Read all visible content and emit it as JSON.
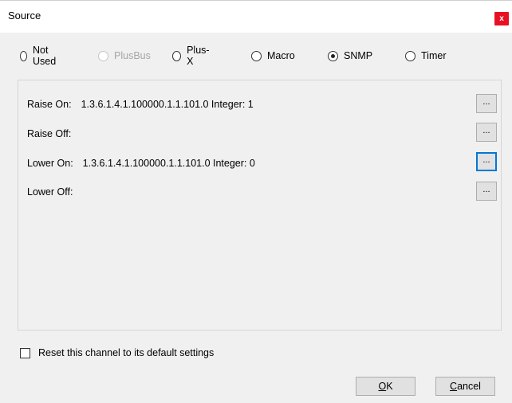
{
  "window": {
    "title": "Source",
    "close_label": "x"
  },
  "source_options": [
    {
      "label": "Not Used",
      "checked": false,
      "disabled": false
    },
    {
      "label": "PlusBus",
      "checked": false,
      "disabled": true
    },
    {
      "label": "Plus-X",
      "checked": false,
      "disabled": false
    },
    {
      "label": "Macro",
      "checked": false,
      "disabled": false
    },
    {
      "label": "SNMP",
      "checked": true,
      "disabled": false
    },
    {
      "label": "Timer",
      "checked": false,
      "disabled": false
    }
  ],
  "snmp": {
    "rows": [
      {
        "label": "Raise On:",
        "value": "1.3.6.1.4.1.100000.1.1.101.0 Integer: 1",
        "button": "..."
      },
      {
        "label": "Raise Off:",
        "value": "",
        "button": "..."
      },
      {
        "label": "Lower On:",
        "value": "1.3.6.1.4.1.100000.1.1.101.0 Integer: 0",
        "button": "..."
      },
      {
        "label": "Lower Off:",
        "value": "",
        "button": "..."
      }
    ]
  },
  "reset": {
    "label": "Reset this channel to its default settings",
    "checked": false
  },
  "buttons": {
    "ok_first": "O",
    "ok_rest": "K",
    "cancel_first": "C",
    "cancel_rest": "ancel"
  }
}
